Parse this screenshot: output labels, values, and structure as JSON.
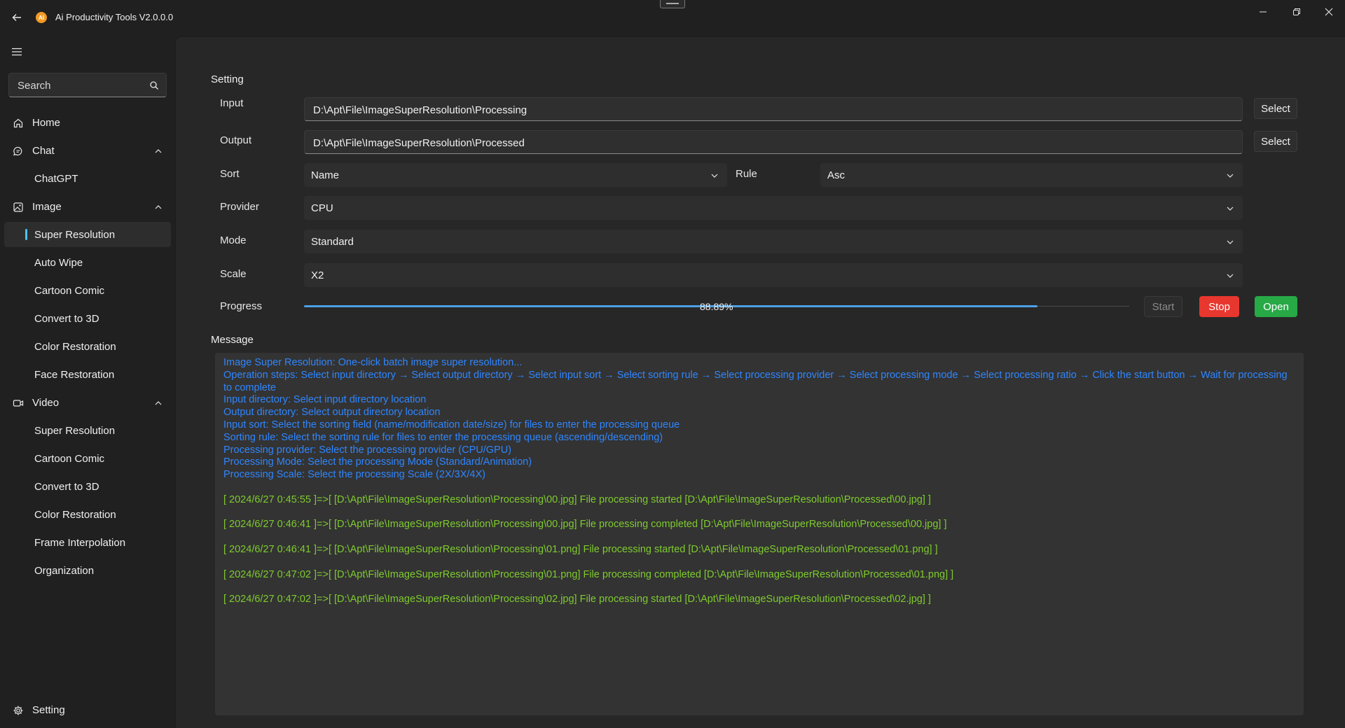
{
  "app": {
    "title": "Ai Productivity Tools V2.0.0.0",
    "logo_text": "AI"
  },
  "window_controls": {
    "minimize": "minimize-icon",
    "restore": "restore-icon",
    "close": "close-icon"
  },
  "search": {
    "placeholder": "Search"
  },
  "sidebar": {
    "items": [
      {
        "label": "Home",
        "icon": "home-icon"
      },
      {
        "label": "Chat",
        "icon": "chat-icon",
        "expanded": true
      },
      {
        "label": "ChatGPT"
      },
      {
        "label": "Image",
        "icon": "image-icon",
        "expanded": true
      },
      {
        "label": "Super Resolution",
        "selected": true
      },
      {
        "label": "Auto Wipe"
      },
      {
        "label": "Cartoon Comic"
      },
      {
        "label": "Convert to 3D"
      },
      {
        "label": "Color Restoration"
      },
      {
        "label": "Face Restoration"
      },
      {
        "label": "Video",
        "icon": "video-icon",
        "expanded": true
      },
      {
        "label": "Super Resolution"
      },
      {
        "label": "Cartoon Comic"
      },
      {
        "label": "Convert to 3D"
      },
      {
        "label": "Color Restoration"
      },
      {
        "label": "Frame Interpolation"
      },
      {
        "label": "Organization"
      }
    ],
    "footer": {
      "label": "Setting",
      "icon": "gear-icon"
    }
  },
  "setting": {
    "title": "Setting",
    "input": {
      "label": "Input",
      "value": "D:\\Apt\\File\\ImageSuperResolution\\Processing",
      "button": "Select"
    },
    "output": {
      "label": "Output",
      "value": "D:\\Apt\\File\\ImageSuperResolution\\Processed",
      "button": "Select"
    },
    "sort": {
      "label": "Sort",
      "value": "Name"
    },
    "rule": {
      "label": "Rule",
      "value": "Asc"
    },
    "provider": {
      "label": "Provider",
      "value": "CPU"
    },
    "mode": {
      "label": "Mode",
      "value": "Standard"
    },
    "scale": {
      "label": "Scale",
      "value": "X2"
    },
    "progress": {
      "label": "Progress",
      "value": 0.8889,
      "text": "88.89%"
    },
    "buttons": {
      "start": "Start",
      "stop": "Stop",
      "open": "Open"
    }
  },
  "message": {
    "title": "Message",
    "info_lines": [
      "Image Super Resolution: One-click batch image super resolution...",
      "Operation steps: Select input directory → Select output directory → Select input sort → Select sorting rule → Select processing provider → Select processing mode → Select processing ratio → Click the start button → Wait for processing to complete",
      "Input directory: Select input directory location",
      "Output directory: Select output directory location",
      "Input sort: Select the sorting field (name/modification date/size) for files to enter the processing queue",
      "Sorting rule: Select the sorting rule for files to enter the processing queue (ascending/descending)",
      "Processing provider: Select the processing provider (CPU/GPU)",
      "Processing Mode: Select the processing Mode (Standard/Animation)",
      "Processing Scale: Select the processing Scale (2X/3X/4X)"
    ],
    "log_lines": [
      "[ 2024/6/27 0:45:55 ]=>[ [D:\\Apt\\File\\ImageSuperResolution\\Processing\\00.jpg] File processing started [D:\\Apt\\File\\ImageSuperResolution\\Processed\\00.jpg] ]",
      "[ 2024/6/27 0:46:41 ]=>[ [D:\\Apt\\File\\ImageSuperResolution\\Processing\\00.jpg] File processing completed [D:\\Apt\\File\\ImageSuperResolution\\Processed\\00.jpg] ]",
      "[ 2024/6/27 0:46:41 ]=>[ [D:\\Apt\\File\\ImageSuperResolution\\Processing\\01.png] File processing started [D:\\Apt\\File\\ImageSuperResolution\\Processed\\01.png] ]",
      "[ 2024/6/27 0:47:02 ]=>[ [D:\\Apt\\File\\ImageSuperResolution\\Processing\\01.png] File processing completed [D:\\Apt\\File\\ImageSuperResolution\\Processed\\01.png] ]",
      "[ 2024/6/27 0:47:02 ]=>[ [D:\\Apt\\File\\ImageSuperResolution\\Processing\\02.jpg] File processing started [D:\\Apt\\File\\ImageSuperResolution\\Processed\\02.jpg] ]"
    ]
  },
  "colors": {
    "accent": "#4cc2ff",
    "progress": "#4ca0e6",
    "info_text": "#2f86ff",
    "log_text": "#7ecb2e",
    "stop": "#e8372e",
    "open": "#27a946",
    "logo": "#f29a22"
  }
}
